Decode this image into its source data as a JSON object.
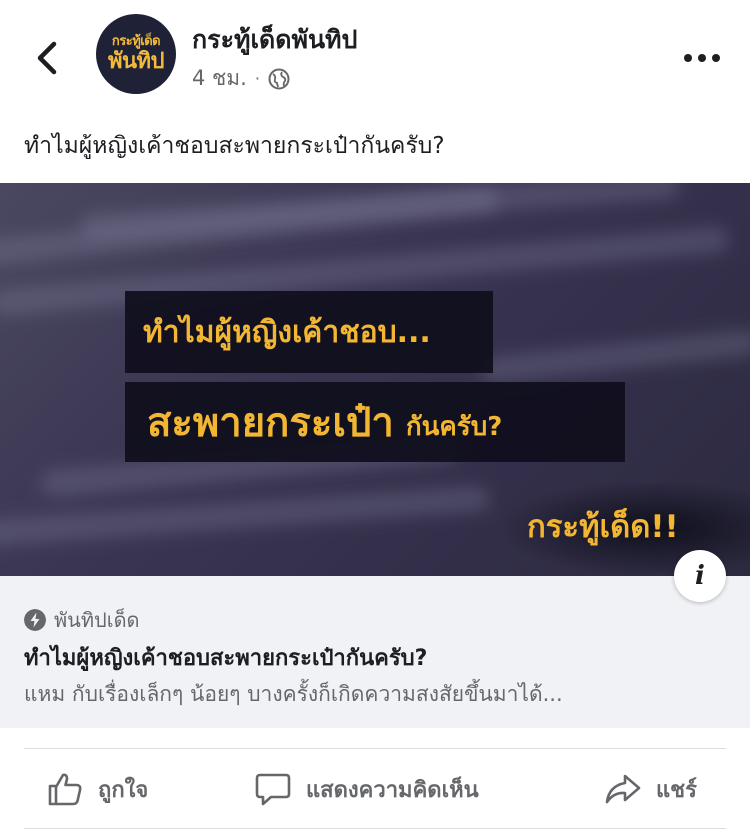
{
  "post": {
    "page_name": "กระทู้เด็ดพันทิป",
    "avatar_line1": "กระทู้เด็ด",
    "avatar_line2": "พันทิป",
    "time": "4 ชม.",
    "separator": "·",
    "text": "ทำไมผู้หญิงเค้าชอบสะพายกระเป๋ากันครับ?"
  },
  "image": {
    "line1": "ทำไมผู้หญิงเค้าชอบ...",
    "line2_big": "สะพายกระเป๋า",
    "line2_small": "กันครับ?",
    "brand": "กระทู้เด็ด!!",
    "info_label": "i"
  },
  "link": {
    "source": "พันทิปเด็ด",
    "title": "ทำไมผู้หญิงเค้าชอบสะพายกระเป๋ากันครับ?",
    "description": "แหม กับเรื่องเล็กๆ น้อยๆ บางครั้งก็เกิดความสงสัยขึ้นมาได้..."
  },
  "actions": {
    "like": "ถูกใจ",
    "comment": "แสดงความคิดเห็น",
    "share": "แชร์"
  },
  "colors": {
    "accent_yellow": "#f2b632",
    "text_secondary": "#65676b",
    "link_background": "#f0f2f5"
  }
}
